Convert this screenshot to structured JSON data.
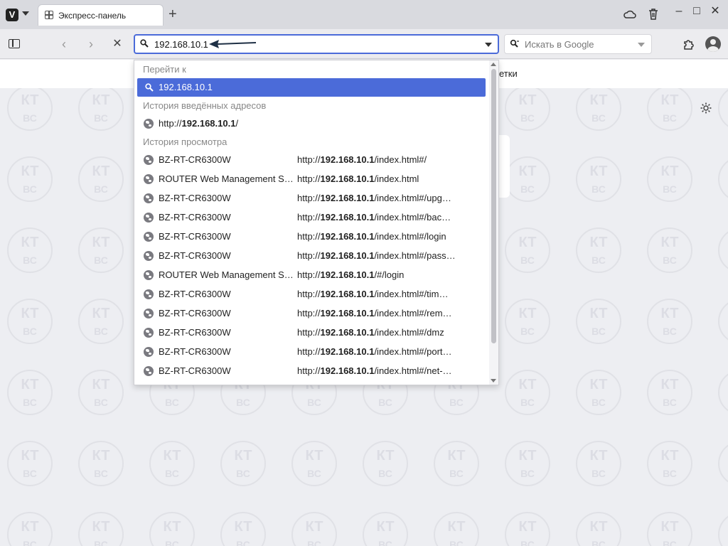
{
  "tabbar": {
    "logo_letter": "V",
    "tab_title": "Экспресс-панель",
    "new_tab_label": "+"
  },
  "window_controls": {
    "cloud_icon": "cloud-icon",
    "trash_icon": "trash-icon",
    "minimize": "–",
    "maximize": "□",
    "close": "✕"
  },
  "toolbar": {
    "back": "‹",
    "forward": "›",
    "stop": "✕",
    "address_value": "192.168.10.1",
    "search_placeholder": "Искать в Google"
  },
  "page": {
    "subbar_text": "етки",
    "watermark_text": "КТ\nВС"
  },
  "dropdown": {
    "section_goto": "Перейти к",
    "goto_item": "192.168.10.1",
    "section_typed": "История введённых адресов",
    "typed_item_prefix": "http://",
    "typed_item_bold": "192.168.10.1",
    "typed_item_suffix": "/",
    "section_history": "История просмотра",
    "history": [
      {
        "title": "BZ-RT-CR6300W",
        "url_prefix": "http://",
        "url_bold": "192.168.10.1",
        "url_suffix": "/index.html#/"
      },
      {
        "title": "ROUTER Web Management Sy…",
        "url_prefix": "http://",
        "url_bold": "192.168.10.1",
        "url_suffix": "/index.html"
      },
      {
        "title": "BZ-RT-CR6300W",
        "url_prefix": "http://",
        "url_bold": "192.168.10.1",
        "url_suffix": "/index.html#/upg…"
      },
      {
        "title": "BZ-RT-CR6300W",
        "url_prefix": "http://",
        "url_bold": "192.168.10.1",
        "url_suffix": "/index.html#/bac…"
      },
      {
        "title": "BZ-RT-CR6300W",
        "url_prefix": "http://",
        "url_bold": "192.168.10.1",
        "url_suffix": "/index.html#/login"
      },
      {
        "title": "BZ-RT-CR6300W",
        "url_prefix": "http://",
        "url_bold": "192.168.10.1",
        "url_suffix": "/index.html#/pass…"
      },
      {
        "title": "ROUTER Web Management Sy…",
        "url_prefix": "http://",
        "url_bold": "192.168.10.1",
        "url_suffix": "/#/login"
      },
      {
        "title": "BZ-RT-CR6300W",
        "url_prefix": "http://",
        "url_bold": "192.168.10.1",
        "url_suffix": "/index.html#/tim…"
      },
      {
        "title": "BZ-RT-CR6300W",
        "url_prefix": "http://",
        "url_bold": "192.168.10.1",
        "url_suffix": "/index.html#/rem…"
      },
      {
        "title": "BZ-RT-CR6300W",
        "url_prefix": "http://",
        "url_bold": "192.168.10.1",
        "url_suffix": "/index.html#/dmz"
      },
      {
        "title": "BZ-RT-CR6300W",
        "url_prefix": "http://",
        "url_bold": "192.168.10.1",
        "url_suffix": "/index.html#/port…"
      },
      {
        "title": "BZ-RT-CR6300W",
        "url_prefix": "http://",
        "url_bold": "192.168.10.1",
        "url_suffix": "/index.html#/net-…"
      }
    ]
  },
  "colors": {
    "accent": "#4b6bd9",
    "arrow": "#1f3045"
  }
}
